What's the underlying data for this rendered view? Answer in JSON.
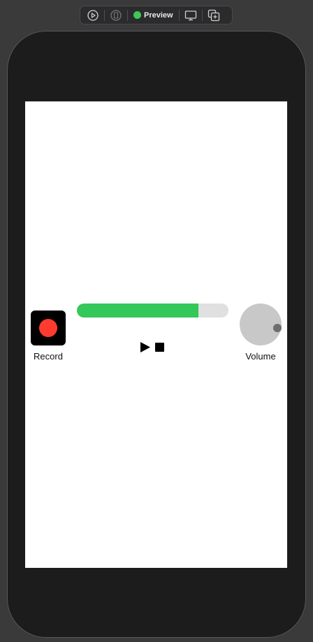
{
  "toolbar": {
    "preview_label": "Preview",
    "icons": [
      "play-circle-icon",
      "device-rotate-icon",
      "live-dot-icon",
      "display-settings-icon",
      "duplicate-icon"
    ],
    "live_color": "#3ec755"
  },
  "controls": {
    "record_label": "Record",
    "volume_label": "Volume",
    "progress_fraction": 0.8,
    "volume_fraction": 0.5,
    "record_color": "#ff3b30",
    "progress_color": "#34c759"
  }
}
